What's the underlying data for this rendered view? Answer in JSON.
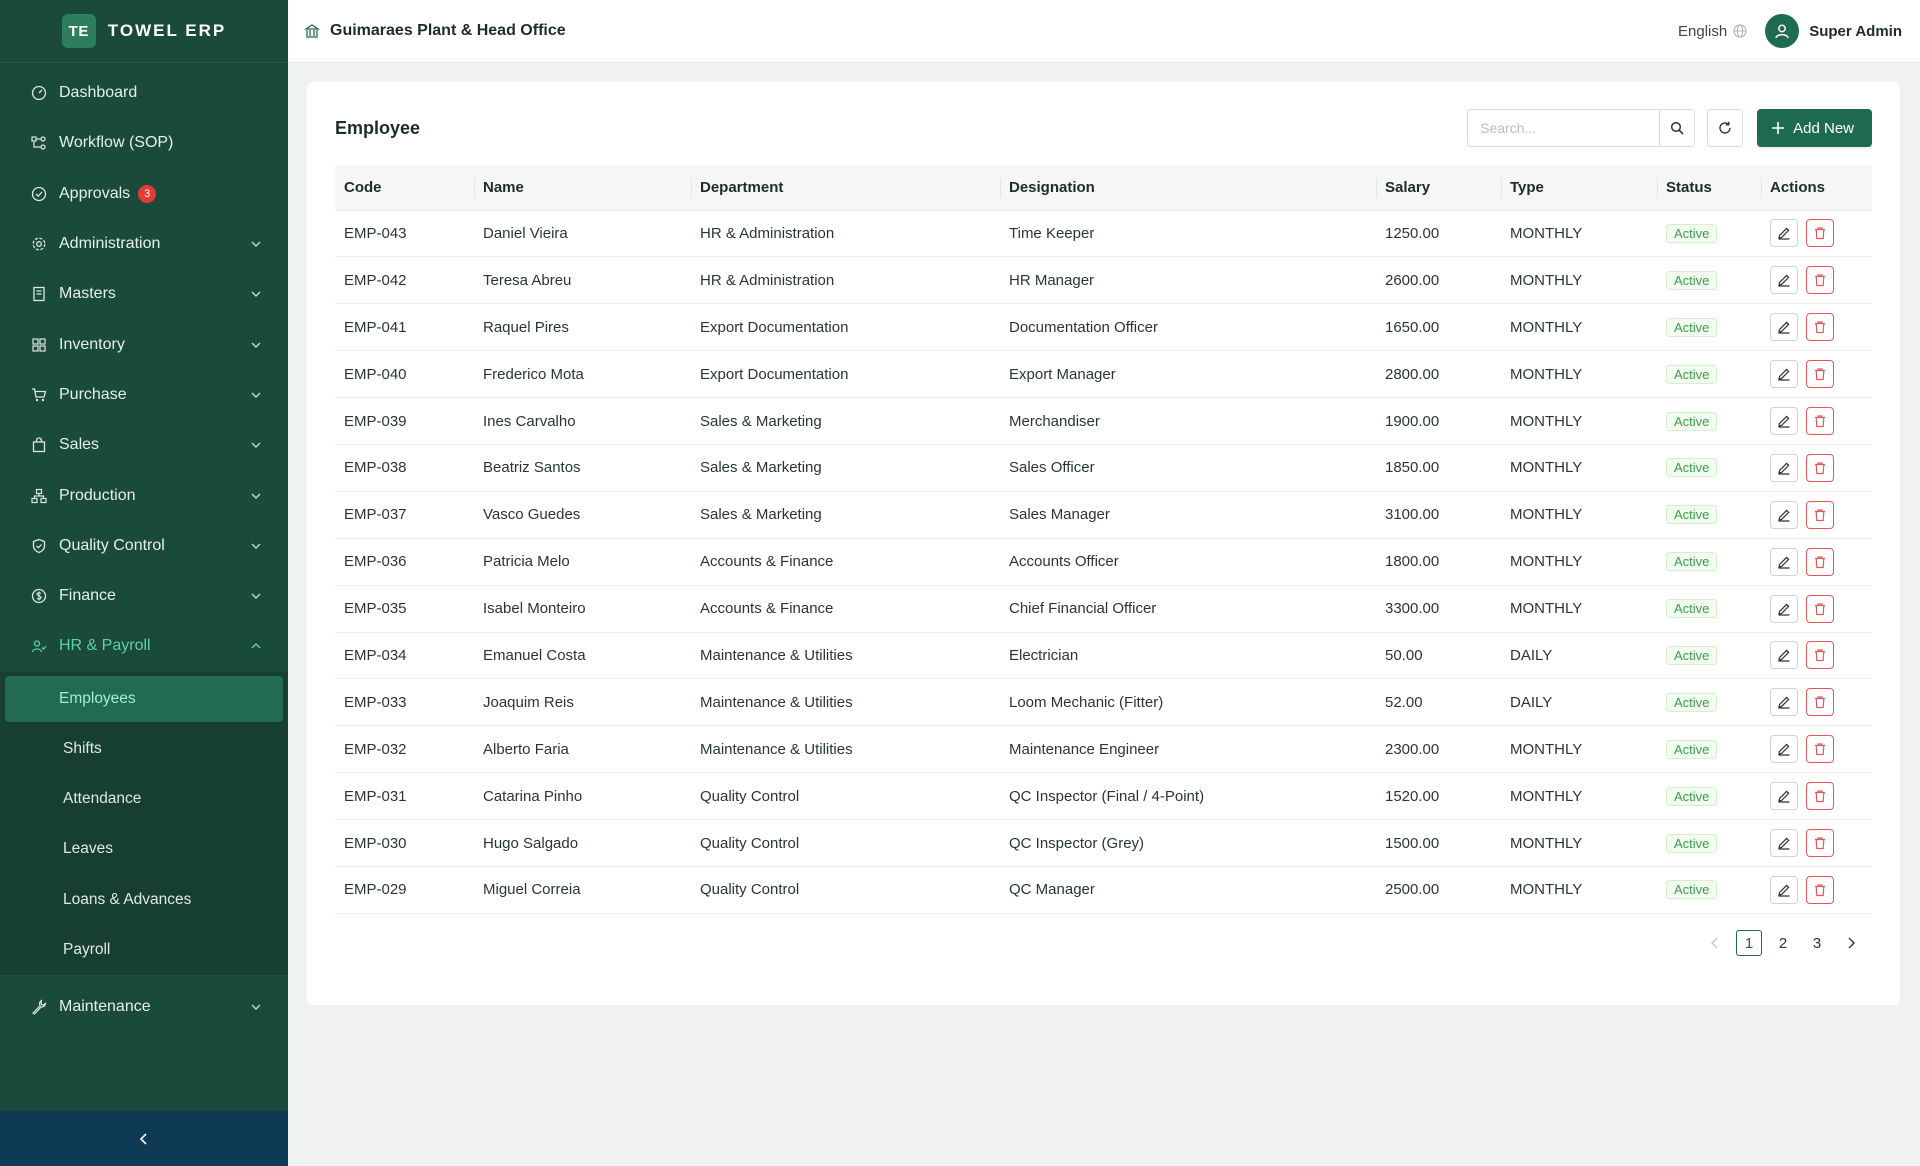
{
  "brand": {
    "logo": "TE",
    "name": "TOWEL ERP"
  },
  "header": {
    "org": "Guimaraes Plant & Head Office",
    "language": "English",
    "user": "Super Admin"
  },
  "nav": [
    {
      "key": "dashboard",
      "label": "Dashboard",
      "icon": "dashboard-icon"
    },
    {
      "key": "workflow",
      "label": "Workflow (SOP)",
      "icon": "workflow-icon"
    },
    {
      "key": "approvals",
      "label": "Approvals",
      "icon": "check-circle-icon",
      "badge": "3"
    },
    {
      "key": "administration",
      "label": "Administration",
      "icon": "gear-icon"
    },
    {
      "key": "masters",
      "label": "Masters",
      "icon": "book-icon"
    },
    {
      "key": "inventory",
      "label": "Inventory",
      "icon": "grid-icon"
    },
    {
      "key": "purchase",
      "label": "Purchase",
      "icon": "cart-icon"
    },
    {
      "key": "sales",
      "label": "Sales",
      "icon": "bag-icon"
    },
    {
      "key": "production",
      "label": "Production",
      "icon": "cluster-icon"
    },
    {
      "key": "quality",
      "label": "Quality Control",
      "icon": "shield-icon"
    },
    {
      "key": "finance",
      "label": "Finance",
      "icon": "dollar-icon"
    },
    {
      "key": "hr",
      "label": "HR & Payroll",
      "icon": "users-icon"
    }
  ],
  "hr_sub": [
    "Employees",
    "Shifts",
    "Attendance",
    "Leaves",
    "Loans & Advances",
    "Payroll"
  ],
  "nav_after": {
    "label": "Maintenance",
    "icon": "wrench-icon"
  },
  "page": {
    "title": "Employee",
    "search_placeholder": "Search...",
    "add_label": "Add New",
    "columns": [
      "Code",
      "Name",
      "Department",
      "Designation",
      "Salary",
      "Type",
      "Status",
      "Actions"
    ],
    "rows": [
      [
        "EMP-043",
        "Daniel Vieira",
        "HR & Administration",
        "Time Keeper",
        "1250.00",
        "MONTHLY",
        "Active"
      ],
      [
        "EMP-042",
        "Teresa Abreu",
        "HR & Administration",
        "HR Manager",
        "2600.00",
        "MONTHLY",
        "Active"
      ],
      [
        "EMP-041",
        "Raquel Pires",
        "Export Documentation",
        "Documentation Officer",
        "1650.00",
        "MONTHLY",
        "Active"
      ],
      [
        "EMP-040",
        "Frederico Mota",
        "Export Documentation",
        "Export Manager",
        "2800.00",
        "MONTHLY",
        "Active"
      ],
      [
        "EMP-039",
        "Ines Carvalho",
        "Sales & Marketing",
        "Merchandiser",
        "1900.00",
        "MONTHLY",
        "Active"
      ],
      [
        "EMP-038",
        "Beatriz Santos",
        "Sales & Marketing",
        "Sales Officer",
        "1850.00",
        "MONTHLY",
        "Active"
      ],
      [
        "EMP-037",
        "Vasco Guedes",
        "Sales & Marketing",
        "Sales Manager",
        "3100.00",
        "MONTHLY",
        "Active"
      ],
      [
        "EMP-036",
        "Patricia Melo",
        "Accounts & Finance",
        "Accounts Officer",
        "1800.00",
        "MONTHLY",
        "Active"
      ],
      [
        "EMP-035",
        "Isabel Monteiro",
        "Accounts & Finance",
        "Chief Financial Officer",
        "3300.00",
        "MONTHLY",
        "Active"
      ],
      [
        "EMP-034",
        "Emanuel Costa",
        "Maintenance & Utilities",
        "Electrician",
        "50.00",
        "DAILY",
        "Active"
      ],
      [
        "EMP-033",
        "Joaquim Reis",
        "Maintenance & Utilities",
        "Loom Mechanic (Fitter)",
        "52.00",
        "DAILY",
        "Active"
      ],
      [
        "EMP-032",
        "Alberto Faria",
        "Maintenance & Utilities",
        "Maintenance Engineer",
        "2300.00",
        "MONTHLY",
        "Active"
      ],
      [
        "EMP-031",
        "Catarina Pinho",
        "Quality Control",
        "QC Inspector (Final / 4-Point)",
        "1520.00",
        "MONTHLY",
        "Active"
      ],
      [
        "EMP-030",
        "Hugo Salgado",
        "Quality Control",
        "QC Inspector (Grey)",
        "1500.00",
        "MONTHLY",
        "Active"
      ],
      [
        "EMP-029",
        "Miguel Correia",
        "Quality Control",
        "QC Manager",
        "2500.00",
        "MONTHLY",
        "Active"
      ]
    ],
    "pages": [
      "1",
      "2",
      "3"
    ],
    "current_page": "1"
  },
  "colors": {
    "sidebar": "#1a4a3a",
    "accent": "#1f6b4f",
    "active_text": "#5fd0a3",
    "danger": "#e05a5a",
    "success": "#3aa04a"
  }
}
